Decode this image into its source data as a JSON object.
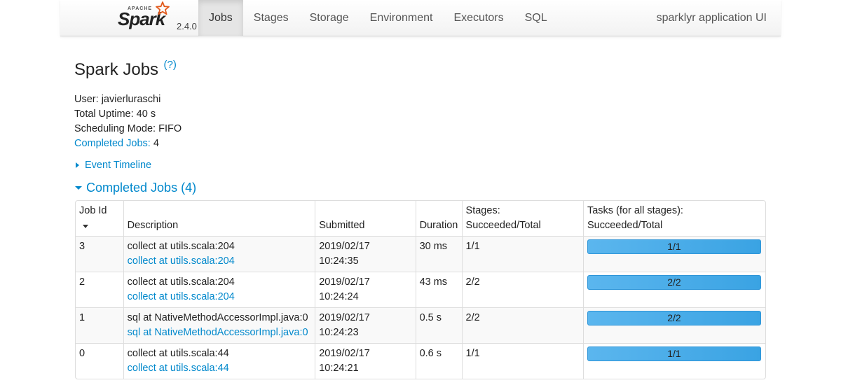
{
  "nav": {
    "brand_apache": "APACHE",
    "brand_name": "Spark",
    "version": "2.4.0",
    "tabs": [
      {
        "label": "Jobs",
        "active": true
      },
      {
        "label": "Stages",
        "active": false
      },
      {
        "label": "Storage",
        "active": false
      },
      {
        "label": "Environment",
        "active": false
      },
      {
        "label": "Executors",
        "active": false
      },
      {
        "label": "SQL",
        "active": false
      }
    ],
    "app_title": "sparklyr application UI"
  },
  "page": {
    "title": "Spark Jobs",
    "help": "(?)",
    "user_label": "User:",
    "user": "javierluraschi",
    "uptime_label": "Total Uptime:",
    "uptime": "40 s",
    "scheduling_label": "Scheduling Mode:",
    "scheduling": "FIFO",
    "completed_label": "Completed Jobs:",
    "completed_count": "4",
    "event_timeline": "Event Timeline",
    "section_title": "Completed Jobs (4)"
  },
  "table": {
    "headers": {
      "job_id": "Job Id",
      "description": "Description",
      "submitted": "Submitted",
      "duration": "Duration",
      "stages_1": "Stages:",
      "stages_2": "Succeeded/Total",
      "tasks_1": "Tasks (for all stages):",
      "tasks_2": "Succeeded/Total"
    },
    "rows": [
      {
        "id": "3",
        "desc": "collect at utils.scala:204",
        "desc_link": "collect at utils.scala:204",
        "date": "2019/02/17",
        "time": "10:24:35",
        "duration": "30 ms",
        "stages": "1/1",
        "tasks": "1/1",
        "progress": 1.0
      },
      {
        "id": "2",
        "desc": "collect at utils.scala:204",
        "desc_link": "collect at utils.scala:204",
        "date": "2019/02/17",
        "time": "10:24:24",
        "duration": "43 ms",
        "stages": "2/2",
        "tasks": "2/2",
        "progress": 1.0
      },
      {
        "id": "1",
        "desc": "sql at NativeMethodAccessorImpl.java:0",
        "desc_link": "sql at NativeMethodAccessorImpl.java:0",
        "date": "2019/02/17",
        "time": "10:24:23",
        "duration": "0.5 s",
        "stages": "2/2",
        "tasks": "2/2",
        "progress": 1.0
      },
      {
        "id": "0",
        "desc": "collect at utils.scala:44",
        "desc_link": "collect at utils.scala:44",
        "date": "2019/02/17",
        "time": "10:24:21",
        "duration": "0.6 s",
        "stages": "1/1",
        "tasks": "1/1",
        "progress": 1.0
      }
    ]
  },
  "colors": {
    "link": "#0088cc",
    "progress": "#3aa3e3",
    "spark_orange": "#e25a1c"
  },
  "icons": {
    "brand_logo": "spark-star-icon",
    "sort": "sort-down-icon",
    "collapsed": "triangle-right-icon",
    "expanded": "triangle-down-icon"
  }
}
